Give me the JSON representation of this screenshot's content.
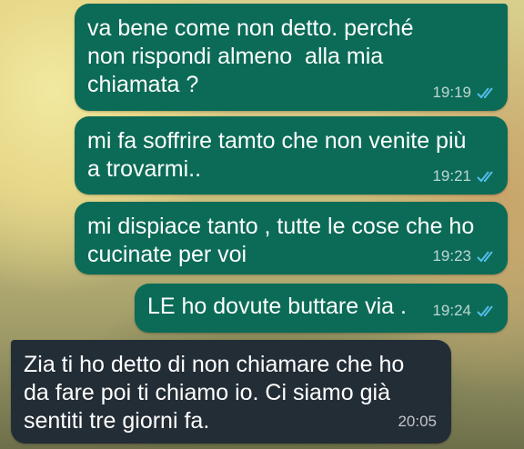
{
  "messages": [
    {
      "direction": "outgoing",
      "text": "va bene come non detto. perché\nnon rispondi almeno  alla mia\nchiamata ?",
      "time": "19:19",
      "status": "read"
    },
    {
      "direction": "outgoing",
      "text": "mi fa soffrire tamto che non venite più\na trovarmi..",
      "time": "19:21",
      "status": "read"
    },
    {
      "direction": "outgoing",
      "text": "mi dispiace tanto , tutte le cose che ho\ncucinate per voi",
      "time": "19:23",
      "status": "read"
    },
    {
      "direction": "outgoing",
      "text": "LE ho dovute buttare via .",
      "time": "19:24",
      "status": "read"
    },
    {
      "direction": "incoming",
      "text": "Zia ti ho detto di non chiamare che ho\nda fare poi ti chiamo io. Ci siamo già\nsentiti tre giorni fa.",
      "time": "20:05"
    }
  ],
  "colors": {
    "outgoing_bubble": "#0b6b57",
    "incoming_bubble": "#232d36",
    "read_ticks": "#53bdeb",
    "text": "#ffffff"
  },
  "icons": {
    "read_receipt": "double-check-icon"
  }
}
